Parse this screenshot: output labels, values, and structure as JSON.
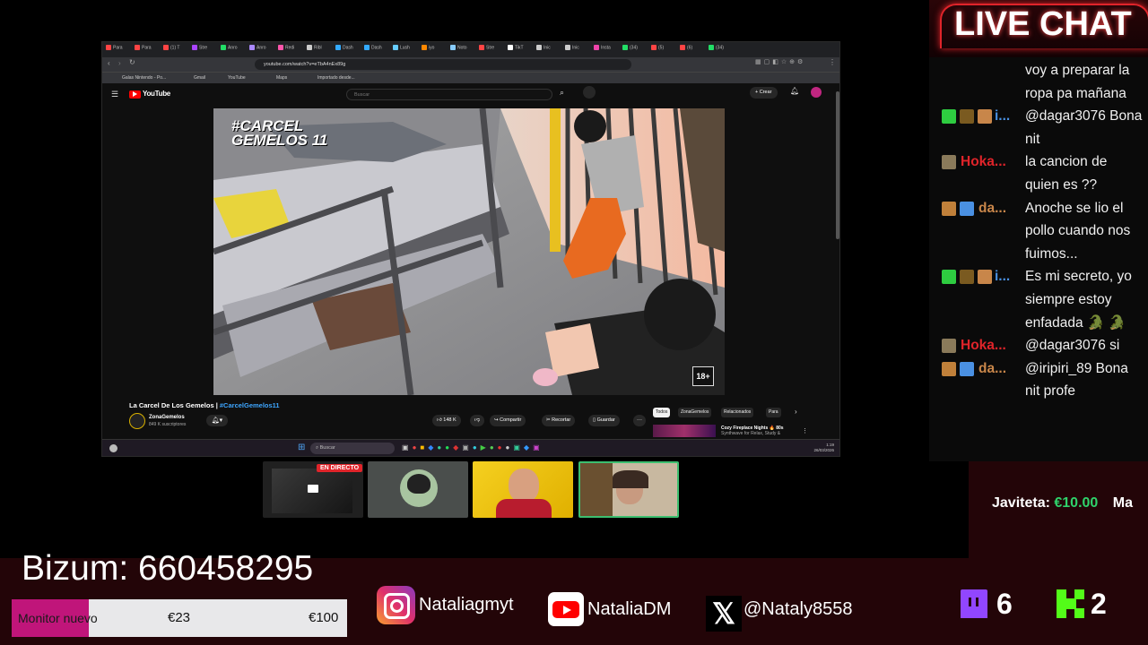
{
  "browser": {
    "tabs": [
      "Para",
      "Para",
      "(1) T",
      "Stre",
      "Anro",
      "Anro",
      "Redi",
      "Ribl",
      "Dash",
      "Dash",
      "Lush",
      "iyo",
      "Noto",
      "Stre",
      "TikT",
      "Inic",
      "Inic",
      "Insta",
      "(34)",
      "(5)",
      "(6)",
      "(34)"
    ],
    "url": "youtube.com/watch?v=eTbA4nEx89g",
    "bookmarks": [
      "Galas Nintendo - Po...",
      "Gmail",
      "YouTube",
      "Maps",
      "Importado desde..."
    ]
  },
  "youtube": {
    "logo": "YouTube",
    "search_placeholder": "Buscar",
    "create_label": "Crear",
    "video_badge_title_line1": "#CARCEL",
    "video_badge_title_line2": "GEMELOS 11",
    "age_badge": "18+",
    "video_title_text": "La Carcel De Los Gemelos | ",
    "video_title_tag": "#CarcelGemelos11",
    "channel_name": "ZonaGemelos",
    "subscribers": "849 K suscriptores",
    "likes": "148 K",
    "share_label": "Compartir",
    "clip_label": "Recortar",
    "save_label": "Guardar",
    "chips": [
      "Todos",
      "ZonaGemelos",
      "Relacionados",
      "Para"
    ],
    "rec_title_line1": "Cozy Fireplace Nights 🔥 80s",
    "rec_title_line2": "Synthwave for Relax, Study &"
  },
  "taskbar": {
    "search_placeholder": "Buscar",
    "time": "1:19",
    "date": "26/03/2026"
  },
  "chat": {
    "title": "LIVE CHAT",
    "messages": [
      {
        "name": "",
        "text_lines": [
          "voy a preparar la",
          "ropa pa mañana"
        ],
        "name_color": "#ffffff"
      },
      {
        "name": "i...",
        "text_lines": [
          "@dagar3076 Bona",
          "nit"
        ],
        "name_color": "#4a90e2"
      },
      {
        "name": "Hoka...",
        "text_lines": [
          "la cancion de",
          "quien es ??"
        ],
        "name_color": "#e0242a"
      },
      {
        "name": "da...",
        "text_lines": [
          "Anoche se lio el",
          "pollo cuando nos",
          "fuimos..."
        ],
        "name_color": "#c8864a"
      },
      {
        "name": "i...",
        "text_lines": [
          "Es mi secreto, yo",
          "siempre estoy",
          "enfadada 🐊 🐊"
        ],
        "name_color": "#4a90e2"
      },
      {
        "name": "Hoka...",
        "text_lines": [
          "@dagar3076 si"
        ],
        "name_color": "#e0242a"
      },
      {
        "name": "da...",
        "text_lines": [
          "@iripiri_89 Bona",
          "nit profe"
        ],
        "name_color": "#c8864a"
      }
    ]
  },
  "donation_ticker": {
    "name": "Javiteta:",
    "amount": "€10.00",
    "next": "Ma"
  },
  "cams": {
    "live_label": "EN DIRECTO"
  },
  "bizum": {
    "label": "Bizum: 660458295"
  },
  "goal": {
    "label": "Monitor nuevo",
    "current": "€23",
    "target": "€100",
    "progress": 0.23,
    "fill_color": "#c0157a"
  },
  "socials": {
    "instagram": "Nataliagmyt",
    "youtube": "NataliaDM",
    "x": "@Nataly8558"
  },
  "counters": {
    "twitch": "6",
    "kick": "2"
  },
  "colors": {
    "accent_red": "#e0242a",
    "kick_green": "#53fc18",
    "twitch_purple": "#9146ff",
    "donation_green": "#2fd36b"
  }
}
